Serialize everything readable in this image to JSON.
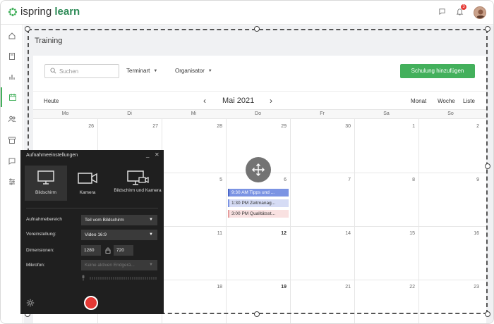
{
  "app": {
    "logo_prefix": "ispring",
    "logo_suffix": "learn",
    "notification_count": "3"
  },
  "page": {
    "title": "Training"
  },
  "toolbar": {
    "search_placeholder": "Suchen",
    "filter_date": "Terminart",
    "filter_organizer": "Organisator",
    "add_button": "Schulung hinzufügen"
  },
  "calendar": {
    "today_label": "Heute",
    "month_title": "Mai 2021",
    "views": [
      "Monat",
      "Woche",
      "Liste"
    ],
    "weekdays": [
      "Mo",
      "Di",
      "Mi",
      "Do",
      "Fr",
      "Sa",
      "So"
    ],
    "weeks": [
      [
        "26",
        "27",
        "28",
        "29",
        "30",
        "1",
        "2"
      ],
      [
        "",
        "",
        "5",
        "6",
        "7",
        "8",
        "9"
      ],
      [
        "",
        "",
        "11",
        "12",
        "14",
        "15",
        "16"
      ],
      [
        "",
        "",
        "18",
        "19",
        "21",
        "22",
        "23"
      ]
    ],
    "events": [
      {
        "label": "9:30 AM Tipps und ..."
      },
      {
        "label": "1:30 PM Zeitmanag..."
      },
      {
        "label": "3:00 PM Qualitätsst..."
      }
    ]
  },
  "recorder": {
    "title": "Aufnahmeeinstellungen",
    "modes": [
      {
        "label": "Bildschirm",
        "selected": true
      },
      {
        "label": "Kamera",
        "selected": false
      },
      {
        "label": "Bildschirm und Kamera",
        "selected": false
      }
    ],
    "area_label": "Aufnahmebereich",
    "area_value": "Teil vom Bildschirm",
    "preset_label": "Voreinstellung:",
    "preset_value": "Video 16:9",
    "dimensions_label": "Dimensionen:",
    "width": "1280",
    "height": "720",
    "mic_label": "Mikrofon:",
    "mic_value": "Keine aktiven Endgerä..."
  },
  "colors": {
    "accent": "#43b05c",
    "record": "#e53935",
    "event_primary": "#7b93e3"
  }
}
